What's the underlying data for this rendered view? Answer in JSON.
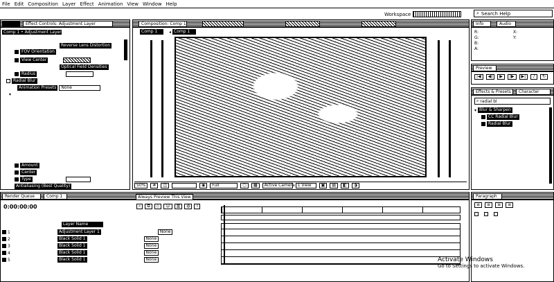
{
  "menu": [
    "File",
    "Edit",
    "Composition",
    "Layer",
    "Effect",
    "Animation",
    "View",
    "Window",
    "Help"
  ],
  "workspace": {
    "label": "Workspace"
  },
  "search": {
    "placeholder": "Search Help"
  },
  "effect_controls": {
    "tab": "Effect Controls: Adjustment Layer",
    "header": "Comp 1 • Adjustment Layer",
    "rows": [
      {
        "label": "FOV Orientation",
        "value": ""
      },
      {
        "label": "View Center",
        "value": ""
      },
      {
        "label": "Optical Field Densities",
        "value": ""
      },
      {
        "label": "Radius",
        "value": ""
      },
      {
        "label": "Radial Blur",
        "value": ""
      },
      {
        "label": "Animation Presets",
        "value": "None"
      }
    ],
    "fx_lens": "Reverse Lens Distortion",
    "bottom_rows": [
      "Amount",
      "Center",
      "Type",
      "Antialiasing (Best Quality)"
    ]
  },
  "composition": {
    "tab": "Composition: Comp 1",
    "subtab": "Comp 1",
    "footer_zoom": "50%",
    "footer_res": "Full",
    "footer_camera": "Active Camera",
    "footer_views": "1 View"
  },
  "info_panel": {
    "tab": "Info",
    "audio_tab": "Audio",
    "r": "R:",
    "g": "G:",
    "b": "B:",
    "a": "A:"
  },
  "preview": {
    "tab": "Preview"
  },
  "effects_presets": {
    "tab": "Effects & Presets",
    "tab2": "Character",
    "search_value": "radial bl",
    "category": "Blur & Sharpen",
    "items": [
      "CC Radial Blur",
      "Radial Blur"
    ]
  },
  "render_queue": {
    "tab": "Render Queue",
    "comp_tab": "Comp 1"
  },
  "timeline": {
    "timecode": "0:00:00:00",
    "tooltip": "Always Preview This View",
    "layer_header": "Layer Name",
    "layers": [
      {
        "num": "1",
        "name": "Adjustment Layer 1"
      },
      {
        "num": "2",
        "name": "Black Solid 1"
      },
      {
        "num": "3",
        "name": "Black Solid 1"
      },
      {
        "num": "4",
        "name": "Black Solid 1"
      },
      {
        "num": "5",
        "name": "Black Solid 1"
      }
    ],
    "parent_value": "None"
  },
  "paragraph": {
    "tab": "Paragraph"
  },
  "watermark": {
    "line1": "Activate Windows",
    "line2": "Go to Settings to activate Windows."
  }
}
